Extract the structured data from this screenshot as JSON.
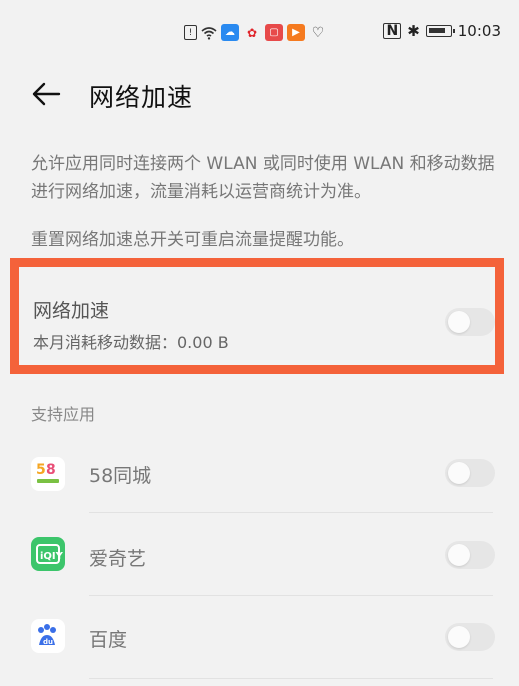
{
  "status_bar": {
    "time": "10:03"
  },
  "header": {
    "title": "网络加速"
  },
  "description": {
    "line1": "允许应用同时连接两个 WLAN 或同时使用 WLAN 和移动数据进行网络加速，流量消耗以运营商统计为准。",
    "line2": "重置网络加速总开关可重启流量提醒功能。"
  },
  "main_toggle": {
    "title": "网络加速",
    "subtitle": "本月消耗移动数据：0.00 B",
    "enabled": false
  },
  "section": {
    "label": "支持应用"
  },
  "apps": [
    {
      "name": "58同城",
      "icon": "58-tongcheng-icon",
      "enabled": false
    },
    {
      "name": "爱奇艺",
      "icon": "iqiyi-icon",
      "enabled": false
    },
    {
      "name": "百度",
      "icon": "baidu-icon",
      "enabled": false
    }
  ],
  "colors": {
    "highlight_border": "#f4623a",
    "background": "#f2f2f2",
    "toggle_off": "#e6e6e6"
  }
}
